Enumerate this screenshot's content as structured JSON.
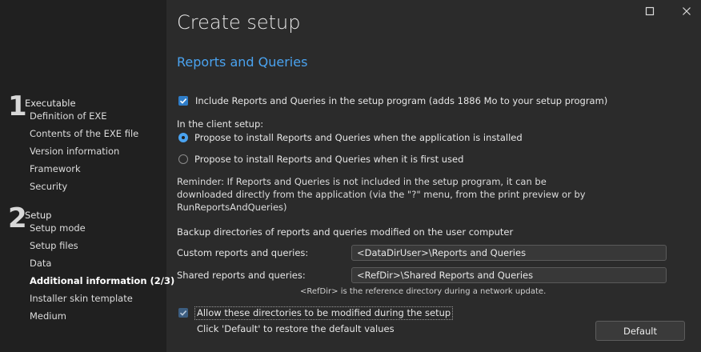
{
  "window": {
    "title": "Create setup",
    "maximize_icon": "maximize-icon",
    "close_icon": "close-icon"
  },
  "sidebar": {
    "groups": [
      {
        "number": "1",
        "title": "Executable",
        "items": [
          {
            "label": "Definition of EXE"
          },
          {
            "label": "Contents of the EXE file"
          },
          {
            "label": "Version information"
          },
          {
            "label": "Framework"
          },
          {
            "label": "Security"
          }
        ]
      },
      {
        "number": "2",
        "title": "Setup",
        "items": [
          {
            "label": "Setup mode"
          },
          {
            "label": "Setup files"
          },
          {
            "label": "Data"
          },
          {
            "label": "Additional information (2/3)",
            "active": true
          },
          {
            "label": "Installer skin template"
          },
          {
            "label": "Medium"
          }
        ]
      }
    ]
  },
  "main": {
    "section_title": "Reports and Queries",
    "include_checkbox": {
      "label": "Include Reports and Queries in the setup program (adds 1886 Mo to your setup program)",
      "checked": true
    },
    "client_setup_label": "In the client setup:",
    "radio_options": [
      {
        "label": "Propose to install Reports and Queries when the application is installed",
        "selected": true
      },
      {
        "label": "Propose to install Reports and Queries when it is first used",
        "selected": false
      }
    ],
    "reminder_text": "Reminder: If Reports and Queries is not included in the setup program, it can be downloaded directly from the application (via the \"?\" menu, from the print preview or by RunReportsAndQueries)",
    "backup_label": "Backup directories of reports and queries modified on the user computer",
    "custom_label": "Custom reports and queries:",
    "custom_value": "<DataDirUser>\\Reports and Queries",
    "shared_label": "Shared reports and queries:",
    "shared_value": "<RefDir>\\Shared Reports and Queries",
    "refdir_hint": "<RefDir> is the reference directory during a network update.",
    "allow_checkbox": {
      "label": "Allow these directories to be modified during the setup",
      "checked": true
    },
    "default_hint": "Click 'Default' to restore the default values",
    "default_button": "Default"
  },
  "colors": {
    "accent": "#4aa3f0",
    "checkbox": "#2f7dc8",
    "background": "#2b2b2b",
    "sidebar": "#202020"
  }
}
